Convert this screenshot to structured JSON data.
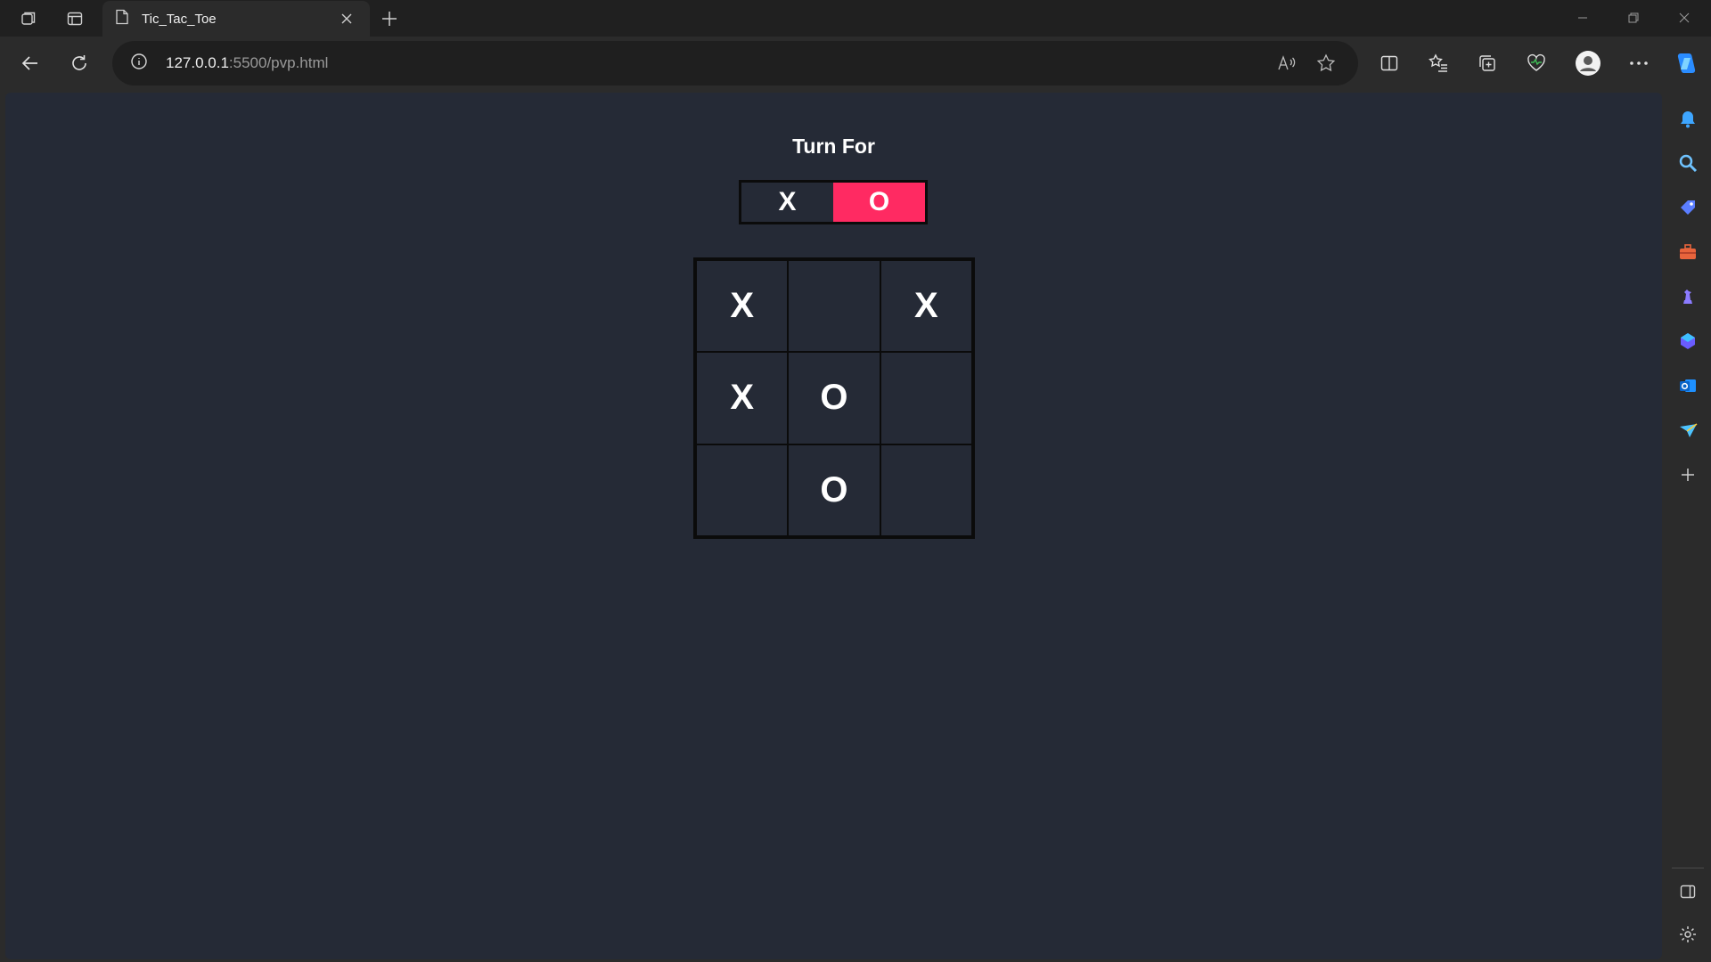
{
  "browser": {
    "tab_title": "Tic_Tac_Toe",
    "url_host": "127.0.0.1",
    "url_rest": ":5500/pvp.html"
  },
  "game": {
    "turn_label": "Turn For",
    "players": [
      "X",
      "O"
    ],
    "current_player": "O",
    "board": [
      "X",
      "",
      "X",
      "X",
      "O",
      "",
      "",
      "O",
      ""
    ]
  },
  "colors": {
    "page_bg": "#252a36",
    "active_turn": "#ff2a62",
    "grid_lines": "#0b0b0b"
  },
  "icons": {
    "sidebar": [
      "bell-icon",
      "search-icon",
      "tag-icon",
      "toolbox-icon",
      "chess-icon",
      "copilot-icon",
      "outlook-icon",
      "send-icon",
      "add-icon",
      "panel-icon",
      "settings-icon"
    ]
  }
}
